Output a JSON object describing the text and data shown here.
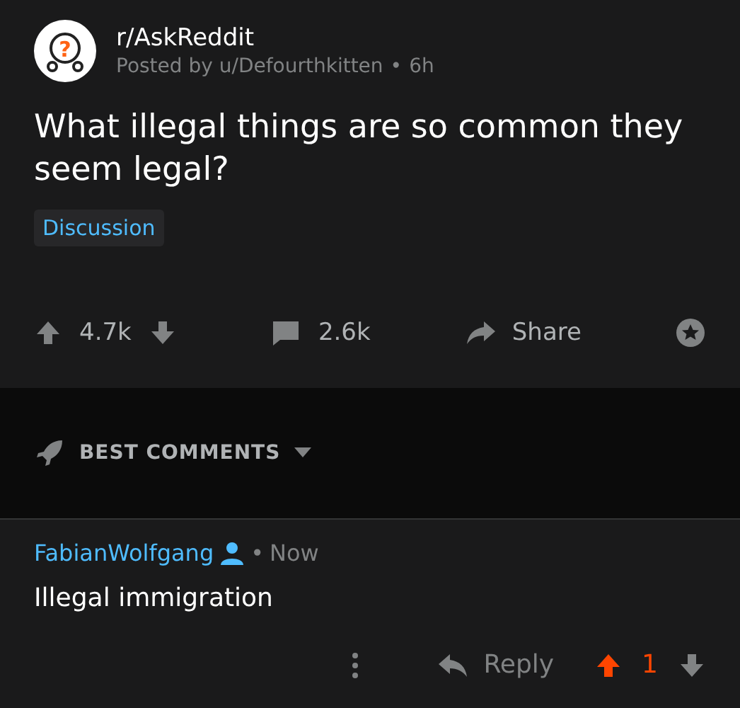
{
  "post": {
    "avatar_mark": "?",
    "subreddit": "r/AskReddit",
    "byline": "Posted by u/Defourthkitten",
    "separator": "•",
    "time": "6h",
    "title": "What illegal things are so common they seem legal?",
    "flair": "Discussion",
    "votes": "4.7k",
    "comments": "2.6k",
    "share": "Share"
  },
  "sort": {
    "label": "BEST COMMENTS"
  },
  "comments": [
    {
      "author": "FabianWolfgang",
      "separator": "•",
      "time": "Now",
      "body": "Illegal immigration",
      "reply": "Reply",
      "votes": "1",
      "upvoted": true
    }
  ]
}
